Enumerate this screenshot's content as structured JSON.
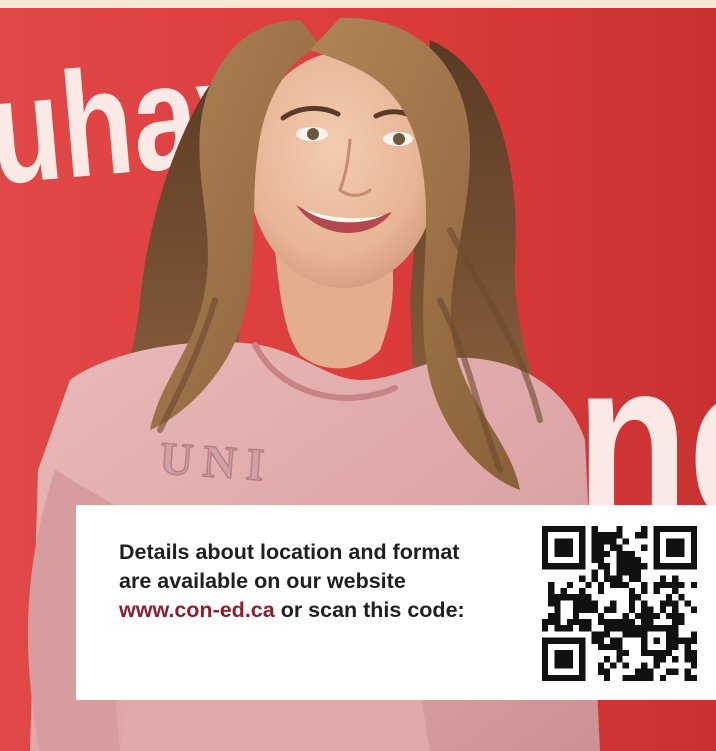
{
  "colors": {
    "top_band": "#f6ead7",
    "backdrop_red": "#dd3c3c",
    "panel_bg": "#ffffff",
    "body_text": "#1f1f1f",
    "link": "#8a1f2e"
  },
  "backdrop": {
    "wall_text_left": "uhay",
    "wall_text_right": "ne"
  },
  "sweater": {
    "print_text": "UNI"
  },
  "info": {
    "text_before_link": "Details about location and format are available on our website ",
    "link_text": "www.con-ed.ca",
    "text_after_link": " or scan this code:"
  },
  "icons": {
    "qr": "qr-code-icon"
  }
}
